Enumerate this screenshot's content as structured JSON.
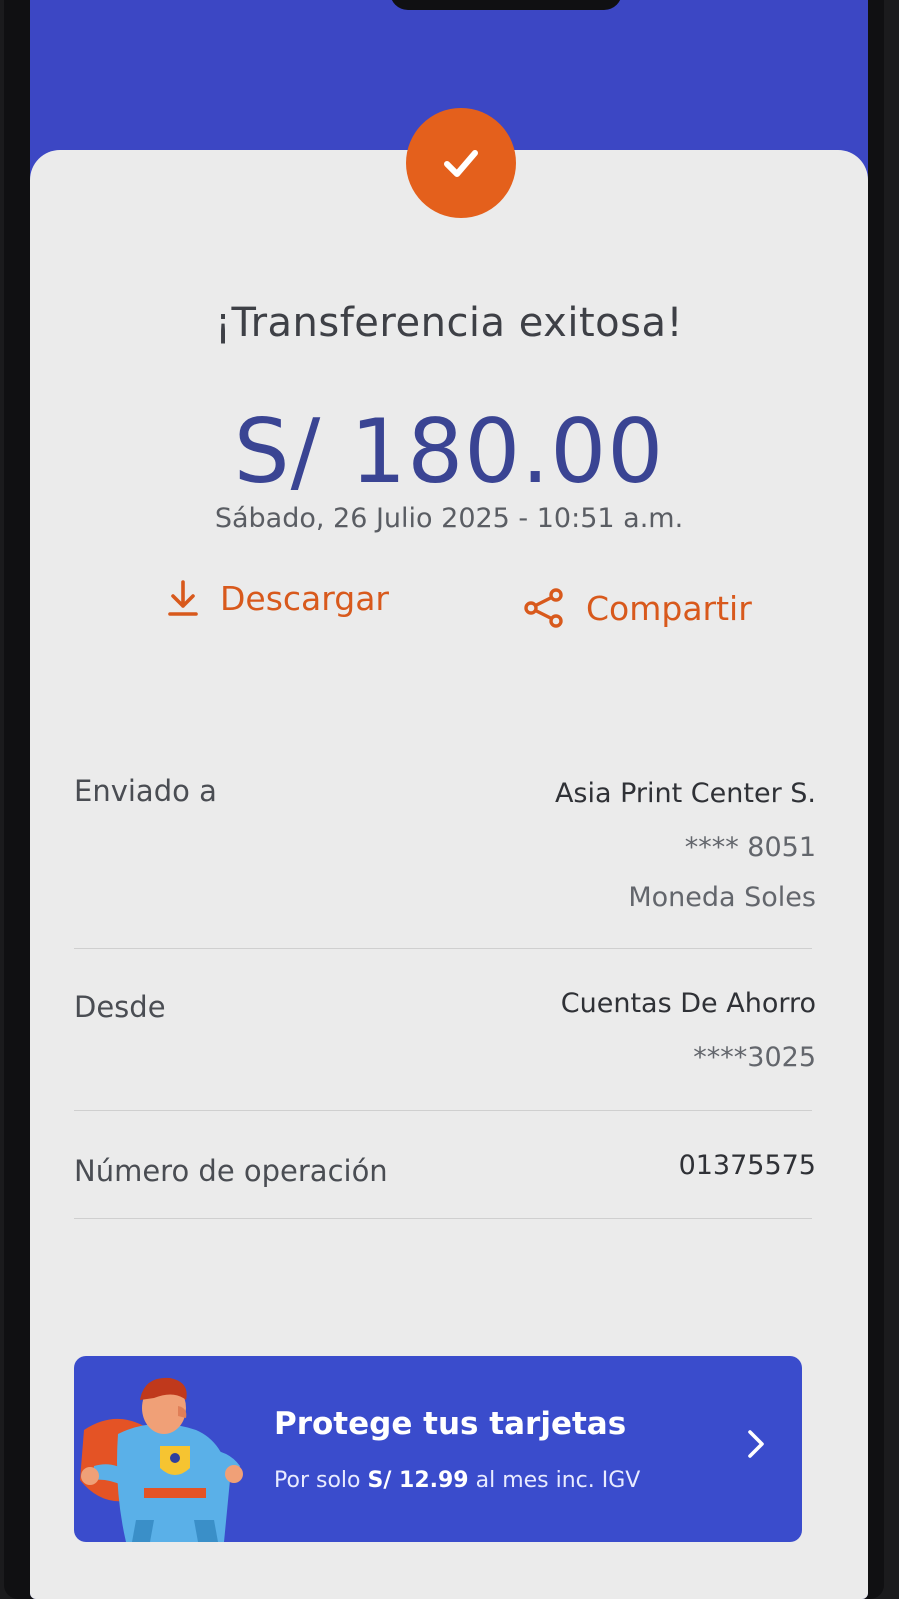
{
  "receipt": {
    "title": "¡Transferencia exitosa!",
    "amount": "S/ 180.00",
    "datetime": "Sábado, 26 Julio 2025 - 10:51 a.m."
  },
  "actions": {
    "download_label": "Descargar",
    "share_label": "Compartir"
  },
  "details": {
    "sent_to": {
      "label": "Enviado a",
      "name": "Asia Print Center S.",
      "account": "**** 8051",
      "currency": "Moneda Soles"
    },
    "from": {
      "label": "Desde",
      "account_type": "Cuentas De Ahorro",
      "account": "****3025"
    },
    "operation": {
      "label": "Número de operación",
      "number": "01375575"
    }
  },
  "promo": {
    "title": "Protege tus tarjetas",
    "sub_prefix": "Por solo ",
    "price": "S/ 12.99",
    "sub_suffix": " al mes inc. IGV"
  },
  "colors": {
    "header_blue": "#3c47c4",
    "accent_orange": "#e4601c",
    "amount_blue": "#3a4493",
    "promo_blue": "#3a4ccc"
  },
  "icons": [
    "check-icon",
    "download-icon",
    "share-icon",
    "chevron-right-icon",
    "superhero-illustration"
  ]
}
